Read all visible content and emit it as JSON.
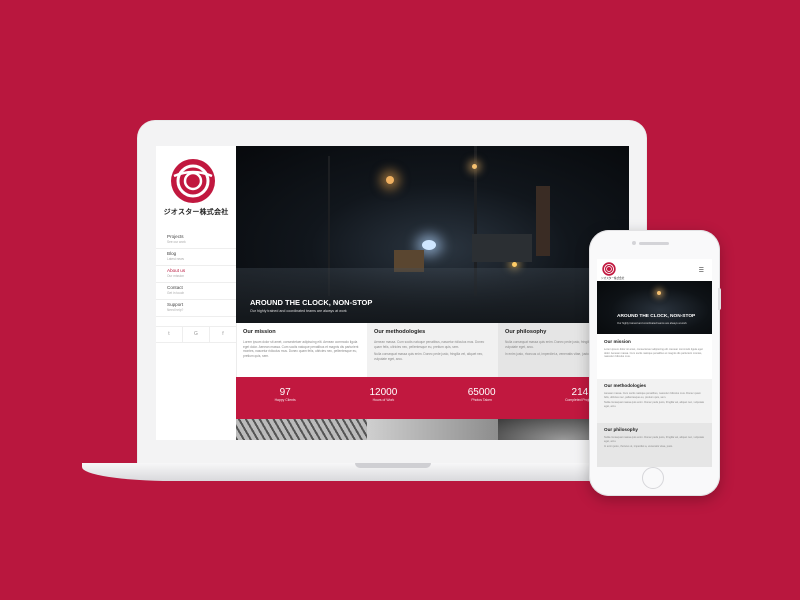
{
  "brand": {
    "name": "ジオスター株式会社",
    "accent": "#b9173e"
  },
  "sidebar": {
    "items": [
      {
        "title": "Projects",
        "subtitle": "See our work",
        "active": false
      },
      {
        "title": "Blog",
        "subtitle": "Latest news",
        "active": false
      },
      {
        "title": "About us",
        "subtitle": "Our mission",
        "active": true
      },
      {
        "title": "Contact",
        "subtitle": "Get in touch",
        "active": false
      },
      {
        "title": "Support",
        "subtitle": "Need help?",
        "active": false
      }
    ],
    "social": [
      {
        "icon": "twitter-icon",
        "glyph": "t"
      },
      {
        "icon": "google-icon",
        "glyph": "G"
      },
      {
        "icon": "facebook-icon",
        "glyph": "f"
      }
    ]
  },
  "hero": {
    "title": "AROUND THE CLOCK, NON-STOP",
    "subtitle": "Our highly trained and coordinated teams are always at work"
  },
  "columns": [
    {
      "heading": "Our mission",
      "paragraphs": [
        "Lorem ipsum dolor sit amet, consectetuer adipiscing elit. Aenean commodo ligula eget dolor. Aenean massa. Cum sociis natoque penatibus et magnis dis parturient montes, nascetur ridiculus mus. Donec quam felis, ultricies nec, pellentesque eu, pretium quis, sem."
      ]
    },
    {
      "heading": "Our methodologies",
      "paragraphs": [
        "Aenean massa. Cum sociis natoque penatibus, nascetur ridiculus mus. Donec quam felis, ultricies nec, pellentesque eu, pretium quis, sem.",
        "Nulla consequat massa quis enim. Donec pede justo, fringilla vel, aliquet nec, vulputate eget, arcu."
      ]
    },
    {
      "heading": "Our philosophy",
      "paragraphs": [
        "Nulla consequat massa quis enim. Donec pede justo, fringilla vel, aliquet nec, vulputate eget, arcu.",
        "In enim justo, rhoncus ut, imperdiet a, venenatis vitae, justo."
      ]
    }
  ],
  "stats": [
    {
      "value": "97",
      "label": "Happy Clients"
    },
    {
      "value": "12000",
      "label": "Hours of Work"
    },
    {
      "value": "65000",
      "label": "Photos Taken"
    },
    {
      "value": "214",
      "label": "Completed Projects"
    }
  ],
  "mobile": {
    "hero_title": "AROUND THE CLOCK, NON-STOP",
    "hero_subtitle": "Our highly trained and coordinated teams are always at work",
    "sections": [
      {
        "heading": "Our mission",
        "paragraphs": [
          "Lorem ipsum dolor sit amet, consectetuer adipiscing elit. Aenean commodo ligula eget dolor. Aenean massa. Cum sociis natoque penatibus et magnis dis parturient montes, nascetur ridiculus mus."
        ]
      },
      {
        "heading": "Our methodologies",
        "paragraphs": [
          "Aenean massa. Cum sociis natoque penatibus, nascetur ridiculus mus. Donec quam felis, ultricies nec, pellentesque eu, pretium quis, sem.",
          "Nulla consequat massa quis enim. Donec pede justo, fringilla vel, aliquet nec, vulputate eget, arcu."
        ]
      },
      {
        "heading": "Our philosophy",
        "paragraphs": [
          "Nulla consequat massa quis enim. Donec pede justo, fringilla vel, aliquet nec, vulputate eget, arcu.",
          "In enim justo, rhoncus ut, imperdiet a, venenatis vitae, justo."
        ]
      }
    ]
  }
}
